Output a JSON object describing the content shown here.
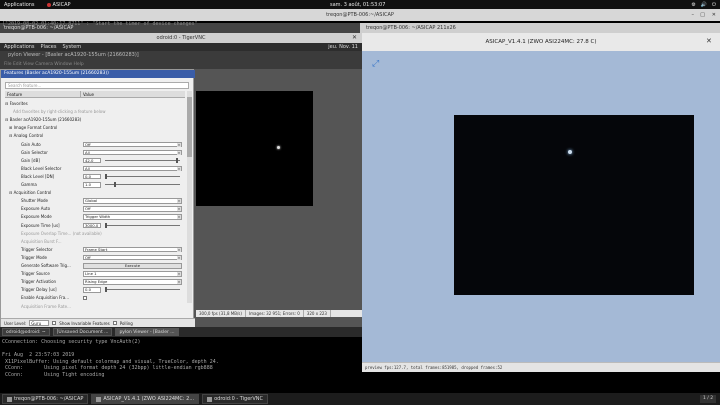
{
  "topbar": {
    "applications": "Applications",
    "app": "ASICAP",
    "clock": "sam. 3 août, 01:53:07",
    "tray": [
      "⚙",
      "🔊",
      "⏻"
    ]
  },
  "terminal": {
    "window_title": "treqon@PTB-006:~/ASICAP",
    "tab1": "treqon@PTB-006: ~/ASICAP",
    "tab2": "treqon@PTB-006: ~/ASICAP 211x26",
    "lines": [
      "[\"2019-08-02 01:40:17.8711\" : \"Start the timer of device changes\"",
      "",
      "",
      "",
      "",
      "",
      "",
      "",
      "",
      "",
      "",
      "",
      "",
      "",
      "",
      "",
      "",
      "",
      "",
      "",
      "",
      "",
      "",
      "",
      "",
      "",
      "",
      "",
      "",
      "",
      "",
      "",
      "",
      "",
      "",
      "",
      "",
      "",
      "",
      "",
      "",
      "",
      "",
      "",
      "",
      "",
      "",
      "",
      "CConnection: Choosing security type VncAuth(2)",
      "",
      "Fri Aug  2 23:57:03 2019",
      " X11PixelBuffer: Using default colormap and visual, TrueColor, depth 24.",
      " CConn:       Using pixel format depth 24 (32bpp) little-endian rgb888",
      " CConn:       Using Tight encoding"
    ]
  },
  "vnc": {
    "title": "odroid:0 - TigerVNC",
    "menu": [
      "Applications",
      "Places",
      "System"
    ],
    "clock": "jeu. Nov. 11",
    "pylon_header": "pylon Viewer - [Basler acA1920-155um (21660283)]",
    "pylon_sub": "File  Edit  View  Camera  Window  Help",
    "features_title": "Features (Basler acA1920-155um (21660283))",
    "search_placeholder": "Search feature...",
    "col_feature": "Feature",
    "col_value": "Value",
    "rows": [
      {
        "label": "⊟ Favorites",
        "indent": 0,
        "type": "cat"
      },
      {
        "label": "Add favorites by right-clicking a feature below",
        "indent": 8,
        "type": "dim"
      },
      {
        "label": "⊟ Basler acA1920-155um (21660283)",
        "indent": 0,
        "type": "cat"
      },
      {
        "label": "⊞ Image Format Control",
        "indent": 4,
        "type": "cat"
      },
      {
        "label": "⊟ Analog Control",
        "indent": 4,
        "type": "cat"
      },
      {
        "label": "Gain Auto",
        "indent": 16,
        "type": "select",
        "value": "Off"
      },
      {
        "label": "Gain Selector",
        "indent": 16,
        "type": "select",
        "value": "All"
      },
      {
        "label": "Gain [dB]",
        "indent": 16,
        "type": "slider",
        "value": "42.0",
        "level": 0.97
      },
      {
        "label": "Black Level Selector",
        "indent": 16,
        "type": "select",
        "value": "All"
      },
      {
        "label": "Black Level [DN]",
        "indent": 16,
        "type": "slider",
        "value": "0.0",
        "level": 0.0
      },
      {
        "label": "Gamma",
        "indent": 16,
        "type": "slider",
        "value": "1.0",
        "level": 0.12
      },
      {
        "label": "⊟ Acquisition Control",
        "indent": 4,
        "type": "cat"
      },
      {
        "label": "Shutter Mode",
        "indent": 16,
        "type": "select",
        "value": "Global"
      },
      {
        "label": "Exposure Auto",
        "indent": 16,
        "type": "select",
        "value": "Off"
      },
      {
        "label": "Exposure Mode",
        "indent": 16,
        "type": "select",
        "value": "Trigger Width"
      },
      {
        "label": "Exposure Time [us]",
        "indent": 16,
        "type": "slider",
        "value": "3000.0",
        "level": 0.0
      },
      {
        "label": "Exposure Overlap Time... (not available)",
        "indent": 16,
        "type": "dim"
      },
      {
        "label": "Acquisition Burst F...",
        "indent": 16,
        "type": "dim"
      },
      {
        "label": "Trigger Selector",
        "indent": 16,
        "type": "select",
        "value": "Frame Start"
      },
      {
        "label": "Trigger Mode",
        "indent": 16,
        "type": "select",
        "value": "Off"
      },
      {
        "label": "Generate Software Trig...",
        "indent": 16,
        "type": "button",
        "value": "Execute"
      },
      {
        "label": "Trigger Source",
        "indent": 16,
        "type": "select",
        "value": "Line 1"
      },
      {
        "label": "Trigger Activation",
        "indent": 16,
        "type": "select",
        "value": "Rising Edge"
      },
      {
        "label": "Trigger Delay [us]",
        "indent": 16,
        "type": "slider",
        "value": "0.0",
        "level": 0.0
      },
      {
        "label": "Enable Acquisition Fra...",
        "indent": 16,
        "type": "cb"
      },
      {
        "label": "Acquisition Frame Rate...",
        "indent": 16,
        "type": "dim"
      }
    ],
    "footer": {
      "user_level_label": "User Level:",
      "user_level": "Guru",
      "show_invisible": "Show Invariable Features",
      "polling": "Polling"
    },
    "status": [
      "300,0 fps (31,8 MB/s)",
      "Images: 32 951; Errors: 0",
      "320 x 223"
    ],
    "taskbar": [
      "odroid@odroid: ~",
      "[Unsaved Document ...",
      "pylon Viewer - [Basler ..."
    ]
  },
  "asicap": {
    "title": "ASICAP_V1.4.1 (ZWO ASI224MC: 27.8 C)",
    "status": "preview fps:127.7, total frames:851985, dropped frames:52"
  },
  "taskbar": {
    "items": [
      "treqon@PTB-006: ~/ASICAP",
      "ASICAP_V1.4.1 (ZWO ASI224MC: 2...",
      "odroid:0 - TigerVNC"
    ],
    "pager": "1 / 2"
  }
}
